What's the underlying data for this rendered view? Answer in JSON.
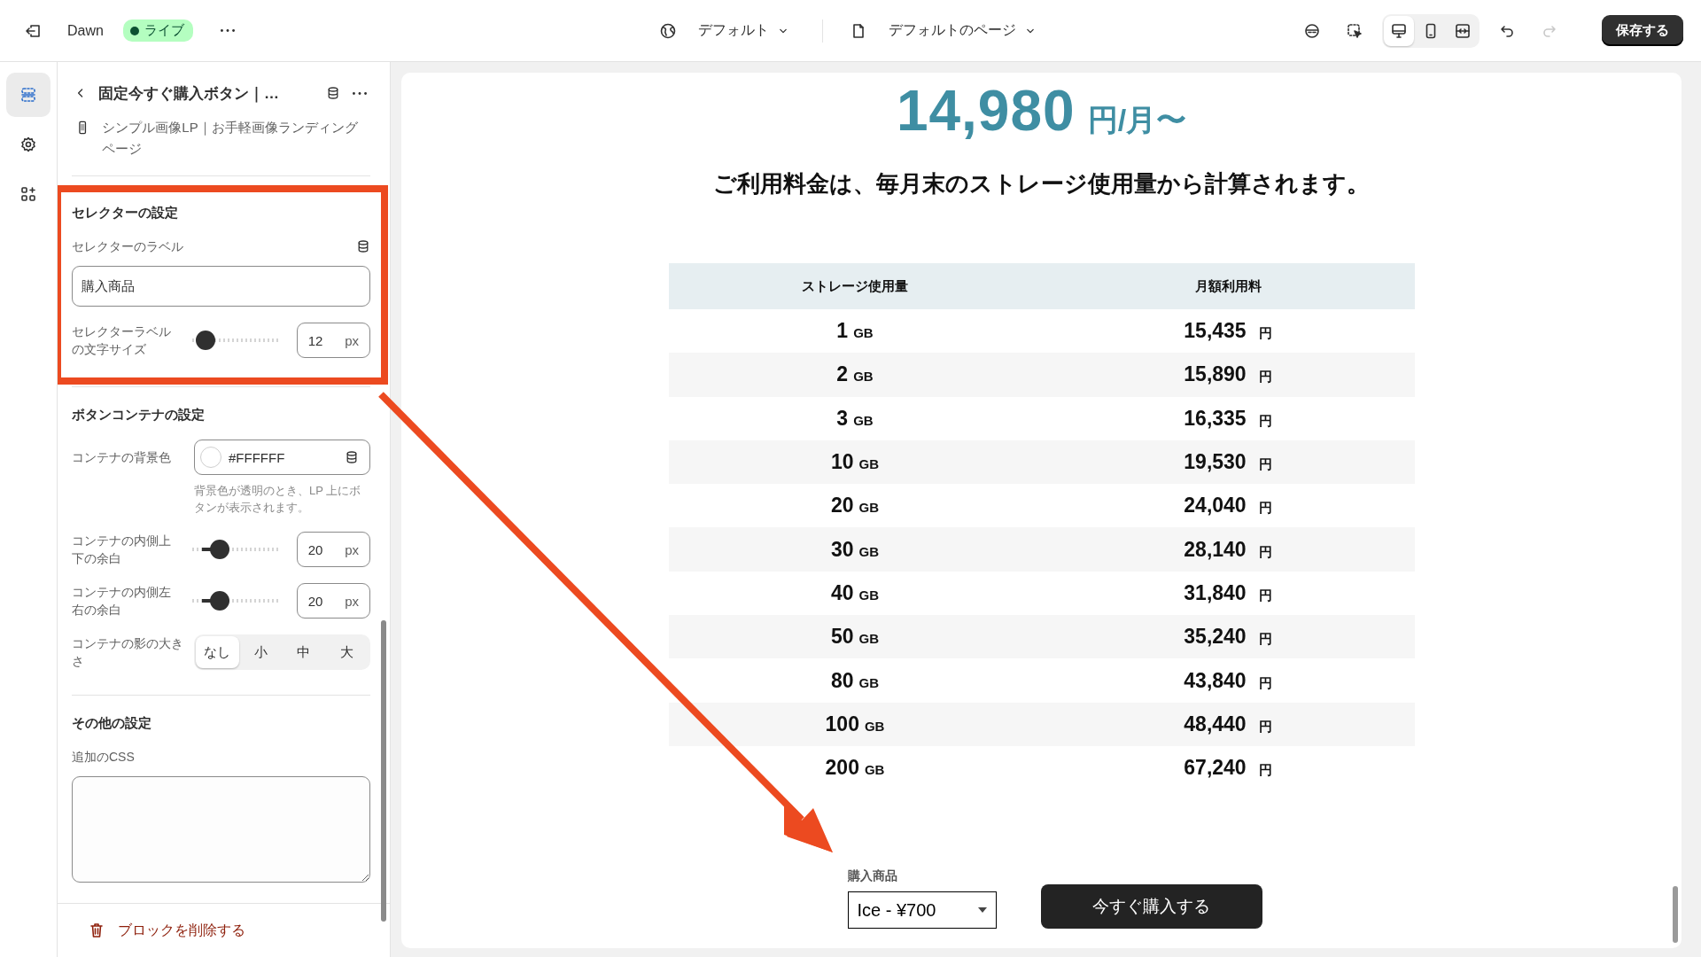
{
  "topbar": {
    "theme": "Dawn",
    "status": "ライブ",
    "template": "デフォルト",
    "page": "デフォルトのページ",
    "devices": [
      {
        "kind": "desktop",
        "selected": true
      },
      {
        "kind": "mobile",
        "selected": false
      },
      {
        "kind": "fullwidth",
        "selected": false
      }
    ],
    "history": [
      {
        "kind": "undo",
        "disabled": false
      },
      {
        "kind": "redo",
        "disabled": true
      }
    ],
    "save": "保存する"
  },
  "rail": [
    {
      "kind": "sections",
      "selected": true
    },
    {
      "kind": "settings",
      "selected": false
    },
    {
      "kind": "apps",
      "selected": false
    }
  ],
  "panel": {
    "title": "固定今すぐ購入ボタン｜…",
    "subtitle": "シンプル画像LP｜お手軽画像ランディングページ",
    "sections": [
      {
        "heading": "セレクターの設定",
        "highlighted": true,
        "settings": [
          {
            "kind": "text",
            "label": "セレクターのラベル",
            "value": "購入商品"
          },
          {
            "kind": "slider",
            "label": "セレクターラベルの文字サイズ",
            "level": 0.05,
            "value": "12",
            "unit": "px"
          }
        ]
      },
      {
        "heading": "ボタンコンテナの設定",
        "highlighted": false,
        "settings": [
          {
            "kind": "color",
            "label": "コンテナの背景色",
            "value": "#FFFFFF",
            "hint": "背景色が透明のとき、LP 上にボタンが表示されます。"
          },
          {
            "kind": "slider",
            "label": "コンテナの内側上下の余白",
            "level": 0.25,
            "value": "20",
            "unit": "px"
          },
          {
            "kind": "slider",
            "label": "コンテナの内側左右の余白",
            "level": 0.25,
            "value": "20",
            "unit": "px"
          },
          {
            "kind": "segmented",
            "label": "コンテナの影の大きさ",
            "options": [
              {
                "label": "なし",
                "selected": true
              },
              {
                "label": "小",
                "selected": false
              },
              {
                "label": "中",
                "selected": false
              },
              {
                "label": "大",
                "selected": false
              }
            ]
          }
        ]
      },
      {
        "heading": "その他の設定",
        "highlighted": false,
        "settings": [
          {
            "kind": "textarea",
            "label": "追加のCSS"
          }
        ]
      }
    ],
    "delete": "ブロックを削除する"
  },
  "preview": {
    "price": "14,980",
    "price_unit": "円/月〜",
    "headline": "ご利用料金は、毎月末のストレージ使用量から計算されます。",
    "table": {
      "columns": [
        "ストレージ使用量",
        "月額利用料"
      ],
      "rows": [
        {
          "storage": "1",
          "unit": "GB",
          "price": "15,435",
          "currency": "円"
        },
        {
          "storage": "2",
          "unit": "GB",
          "price": "15,890",
          "currency": "円"
        },
        {
          "storage": "3",
          "unit": "GB",
          "price": "16,335",
          "currency": "円"
        },
        {
          "storage": "10",
          "unit": "GB",
          "price": "19,530",
          "currency": "円"
        },
        {
          "storage": "20",
          "unit": "GB",
          "price": "24,040",
          "currency": "円"
        },
        {
          "storage": "30",
          "unit": "GB",
          "price": "28,140",
          "currency": "円"
        },
        {
          "storage": "40",
          "unit": "GB",
          "price": "31,840",
          "currency": "円"
        },
        {
          "storage": "50",
          "unit": "GB",
          "price": "35,240",
          "currency": "円"
        },
        {
          "storage": "80",
          "unit": "GB",
          "price": "43,840",
          "currency": "円"
        },
        {
          "storage": "100",
          "unit": "GB",
          "price": "48,440",
          "currency": "円"
        },
        {
          "storage": "200",
          "unit": "GB",
          "price": "67,240",
          "currency": "円"
        }
      ]
    },
    "selector_label": "購入商品",
    "selector_value": "Ice - ¥700",
    "buy": "今すぐ購入する"
  }
}
